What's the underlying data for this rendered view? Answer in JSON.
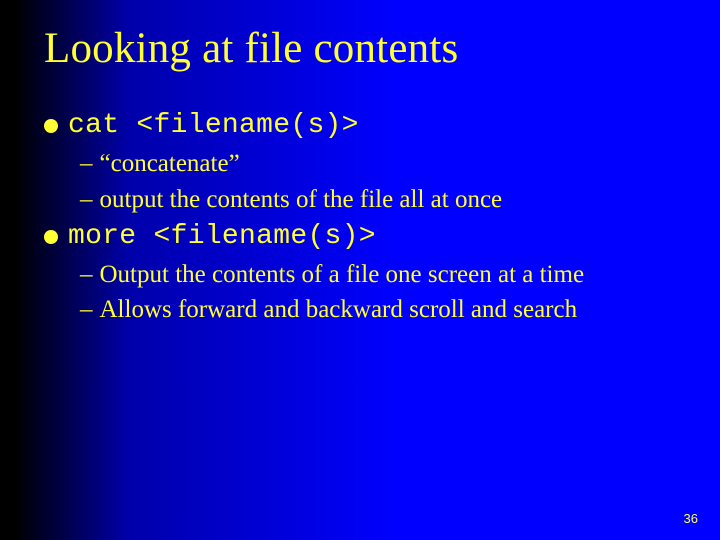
{
  "slide": {
    "title": "Looking at file contents",
    "page_number": "36"
  },
  "items": [
    {
      "cmd_label": "cat <filename(s)>",
      "subs": [
        "“concatenate”",
        "output the contents of the file all at once"
      ]
    },
    {
      "cmd_label": "more <filename(s)>",
      "subs": [
        "Output the contents of a file one screen at a time",
        "Allows forward and backward scroll and search"
      ]
    }
  ]
}
